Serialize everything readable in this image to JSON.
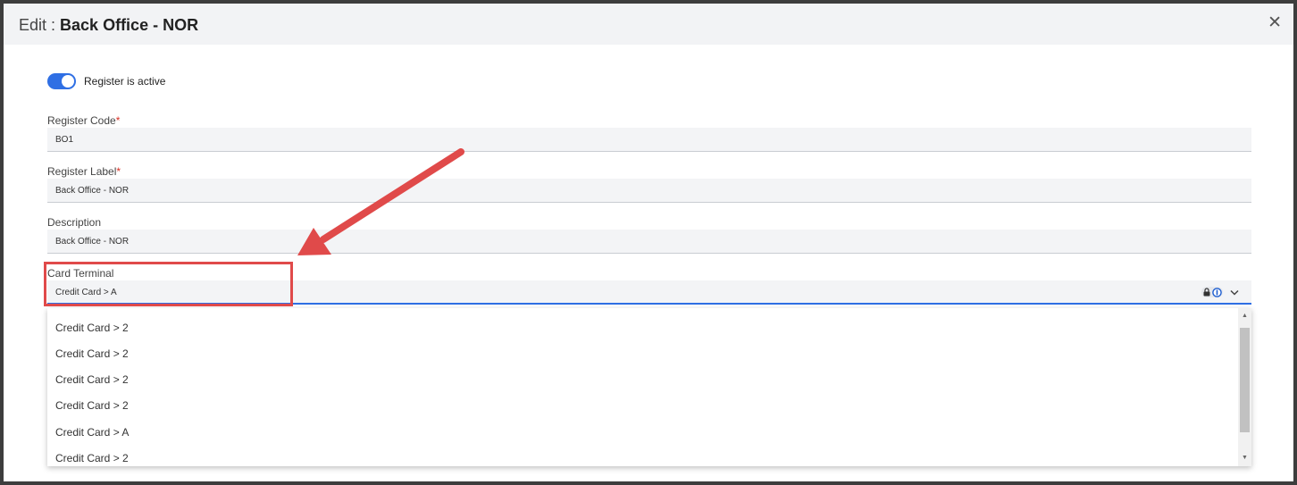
{
  "dialog": {
    "title_prefix": "Edit : ",
    "title_name": "Back Office - NOR",
    "close_symbol": "✕"
  },
  "toggle": {
    "label": "Register is active",
    "on": true
  },
  "fields": {
    "register_code": {
      "label": "Register Code",
      "required_mark": "*",
      "value": "BO1"
    },
    "register_label": {
      "label": "Register Label",
      "required_mark": "*",
      "value": "Back Office - NOR"
    },
    "description": {
      "label": "Description",
      "value": "Back Office - NOR"
    },
    "card_terminal": {
      "label": "Card Terminal",
      "value": "Credit Card > A"
    }
  },
  "dropdown": {
    "options": [
      "Credit Card > 2",
      "Credit Card > 2",
      "Credit Card > 2",
      "Credit Card > 2",
      "Credit Card > A",
      "Credit Card > 2"
    ]
  },
  "icons": {
    "close": "close-icon",
    "lock": "lock-icon",
    "password_manager": "password-manager-icon",
    "chevron": "chevron-down-icon",
    "scroll_up": "scroll-up-arrow",
    "scroll_down": "scroll-down-arrow"
  },
  "colors": {
    "accent": "#2f6fe4",
    "required": "#d93025",
    "annotation": "#e04a4a",
    "header_bg": "#f2f3f5",
    "input_bg": "#f3f4f6"
  }
}
